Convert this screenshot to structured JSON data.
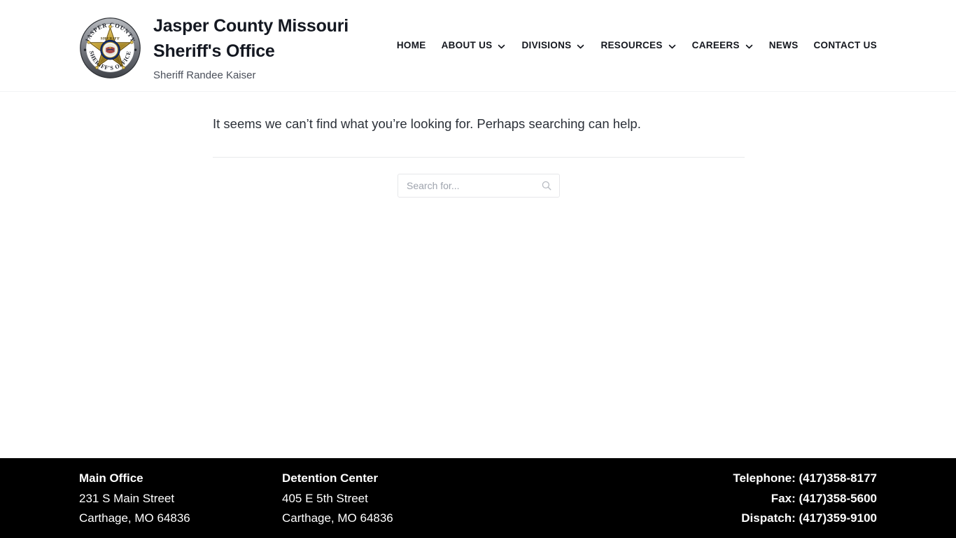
{
  "header": {
    "logo": {
      "icon": "sheriff-badge-icon",
      "ring_top_text": "JASPER COUNTY",
      "ring_bottom_text": "SHERIFF'S OFFICE",
      "star_text": "SHERIFF",
      "colors": {
        "ring": "#8d9096",
        "ring_dark": "#4c4f55",
        "star_gold": "#c9a227",
        "star_gold_dark": "#8a6d16",
        "seal_blue": "#17306b",
        "seal_white": "#f4f4f2"
      }
    },
    "title_line1": "Jasper County Missouri",
    "title_line2": "Sheriff's Office",
    "subtitle": "Sheriff Randee Kaiser",
    "nav": [
      {
        "label": "HOME",
        "has_dropdown": false
      },
      {
        "label": "ABOUT US",
        "has_dropdown": true
      },
      {
        "label": "DIVISIONS",
        "has_dropdown": true
      },
      {
        "label": "RESOURCES",
        "has_dropdown": true
      },
      {
        "label": "CAREERS",
        "has_dropdown": true
      },
      {
        "label": "NEWS",
        "has_dropdown": false
      },
      {
        "label": "CONTACT US",
        "has_dropdown": false
      }
    ]
  },
  "main": {
    "message": "It seems we can’t find what you’re looking for. Perhaps searching can help.",
    "search": {
      "placeholder": "Search for...",
      "value": "",
      "button_icon": "search-icon"
    }
  },
  "footer": {
    "columns": [
      {
        "heading": "Main Office",
        "lines": [
          "231 S Main Street",
          "Carthage, MO 64836"
        ]
      },
      {
        "heading": "Detention Center",
        "lines": [
          "405 E 5th Street",
          "Carthage, MO 64836"
        ]
      }
    ],
    "contact": [
      "Telephone: (417)358-8177",
      "Fax: (417)358-5600",
      "Dispatch: (417)359-9100"
    ]
  },
  "colors": {
    "page_bg": "#ffffff",
    "text": "#1a1d23",
    "footer_bg": "#000000",
    "footer_text": "#ffffff",
    "divider": "#e9eaec"
  }
}
